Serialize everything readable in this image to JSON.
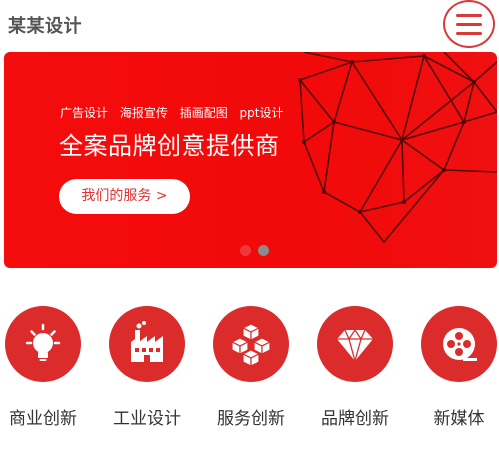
{
  "header": {
    "logo_text": "某某设计",
    "menu_icon": "hamburger-menu-icon",
    "accent_color": "#d83a3a"
  },
  "banner": {
    "tags": [
      "广告设计",
      "海报宣传",
      "插画配图",
      "ppt设计"
    ],
    "headline": "全案品牌创意提供商",
    "cta_label": "我们的服务 >",
    "background_color": "#f20a0a",
    "slide_count": 2,
    "active_slide": 1
  },
  "categories": [
    {
      "label": "商业创新",
      "icon": "lightbulb-icon"
    },
    {
      "label": "工业设计",
      "icon": "factory-icon"
    },
    {
      "label": "服务创新",
      "icon": "cubes-icon"
    },
    {
      "label": "品牌创新",
      "icon": "diamond-icon"
    },
    {
      "label": "新媒体",
      "icon": "film-reel-icon"
    }
  ],
  "colors": {
    "brand_red": "#dc2b2b",
    "text_dark": "#333333"
  }
}
